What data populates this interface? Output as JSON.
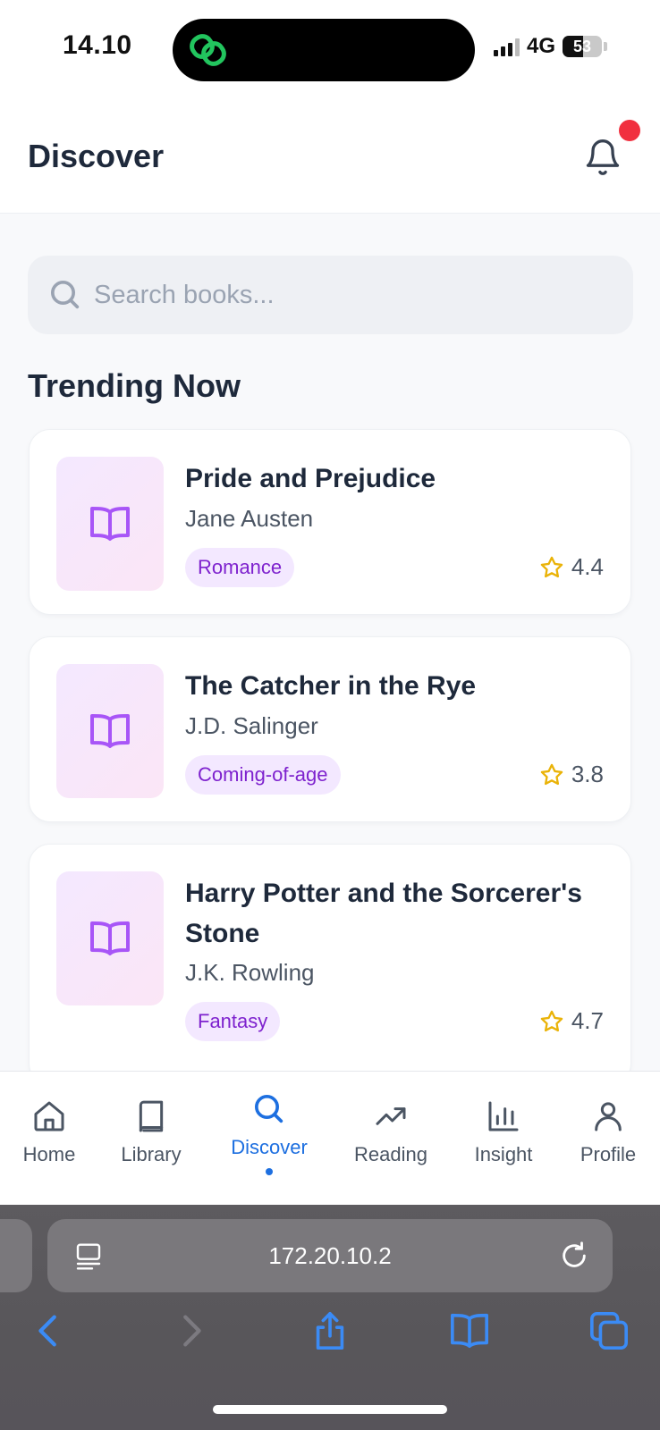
{
  "status_bar": {
    "time": "14.10",
    "network": "4G",
    "battery": "53",
    "battery_level": 0.53
  },
  "header": {
    "title": "Discover"
  },
  "search": {
    "placeholder": "Search books..."
  },
  "section": {
    "title": "Trending Now"
  },
  "books": [
    {
      "title": "Pride and Prejudice",
      "author": "Jane Austen",
      "genre": "Romance",
      "rating": "4.4"
    },
    {
      "title": "The Catcher in the Rye",
      "author": "J.D. Salinger",
      "genre": "Coming-of-age",
      "rating": "3.8"
    },
    {
      "title": "Harry Potter and the Sorcerer's Stone",
      "author": "J.K. Rowling",
      "genre": "Fantasy",
      "rating": "4.7"
    }
  ],
  "nav": {
    "items": [
      {
        "label": "Home",
        "icon": "home-icon"
      },
      {
        "label": "Library",
        "icon": "book-icon"
      },
      {
        "label": "Discover",
        "icon": "search-icon",
        "active": true
      },
      {
        "label": "Reading",
        "icon": "trending-up-icon"
      },
      {
        "label": "Insight",
        "icon": "bar-chart-icon"
      },
      {
        "label": "Profile",
        "icon": "user-icon"
      }
    ]
  },
  "browser": {
    "url": "172.20.10.2"
  },
  "colors": {
    "accent": "#1d6fe0",
    "tag_bg": "#f3e8ff",
    "tag_text": "#7e22ce",
    "star": "#eab308",
    "notification": "#f1303f"
  }
}
